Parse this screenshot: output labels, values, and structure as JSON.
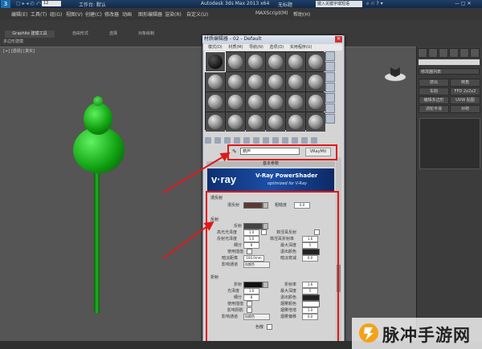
{
  "app": {
    "title": "工作台: 默认",
    "title_center": "Autodesk 3ds Max 2013 x64",
    "title_file": "无标题",
    "search_placeholder": "键入关键字或短语",
    "toolbar_dropdown": "12"
  },
  "menubar": [
    "编辑(E)",
    "工具(T)",
    "组(G)",
    "视图(V)",
    "创建(C)",
    "修改器",
    "动画",
    "图形编辑器",
    "渲染(R)",
    "自定义(U)",
    "MAXScript(M)",
    "帮助(H)"
  ],
  "ribbon": {
    "active_tab": "Graphite 建模工具",
    "tabs": [
      "自由形式",
      "选择",
      "对象绘制"
    ],
    "subtab": "多边形建模"
  },
  "viewport": {
    "label": "[+] [透视] [真实]"
  },
  "command_panel": {
    "dropdown": "修改器列表",
    "buttons": [
      "挤出",
      "倒角",
      "车削",
      "FFD 2x2x2",
      "编辑多边形",
      "UVW 贴图",
      "涡轮平滑",
      "对称"
    ]
  },
  "material_editor": {
    "title": "材质编辑器 - 02 - Default",
    "menu": [
      "模式(D)",
      "材质(M)",
      "导航(N)",
      "选项(O)",
      "实用程序(U)"
    ],
    "slot_count": 24,
    "selected_slot": 0,
    "material_name": "葫芦",
    "material_type": "VRayMtl",
    "basic_rollout": "基本参数",
    "vray_brand": "v·ray",
    "vray_title": "V-Ray PowerShader",
    "vray_subtitle": "optimized for V-Ray",
    "diffuse": {
      "group": "漫反射",
      "label": "漫反射",
      "rough_label": "粗糙度",
      "rough": "0.0"
    },
    "reflection": {
      "group": "反射",
      "reflect": "反射",
      "hilight": "高光光泽度",
      "hilight_val": "1.0",
      "refl_gloss": "反射光泽度",
      "refl_gloss_val": "1.0",
      "subdivs": "细分",
      "subdivs_val": "8",
      "use_interp": "使用插值",
      "dim_dist": "暗淡距离",
      "dim_dist_val": "100.0mm",
      "affect_ch": "影响通道",
      "affect_ch_val": "仅颜色",
      "fresnel": "菲涅耳反射",
      "fresnel_ior": "菲涅耳折射率",
      "fresnel_ior_val": "1.6",
      "max_depth": "最大深度",
      "max_depth_val": "5",
      "exit_color": "退出颜色",
      "dim_falloff": "暗淡衰减",
      "dim_falloff_val": "0.0"
    },
    "refraction": {
      "group": "折射",
      "refract": "折射",
      "ior": "折射率",
      "ior_val": "1.6",
      "gloss": "光泽度",
      "gloss_val": "1.0",
      "max_depth": "最大深度",
      "max_depth_val": "5",
      "subdivs": "细分",
      "subdivs_val": "8",
      "exit_color": "退出颜色",
      "use_interp": "使用插值",
      "fog_color": "烟雾颜色",
      "affect_shadows": "影响阴影",
      "fog_mult": "烟雾倍增",
      "fog_mult_val": "1.0",
      "affect_ch": "影响通道",
      "affect_ch_val": "仅颜色",
      "fog_bias": "烟雾偏移",
      "fog_bias_val": "0.0",
      "dispersion": "色散"
    }
  },
  "watermark": {
    "text": "脉冲手游网"
  },
  "colors": {
    "gourd": "#13a513",
    "highlight": "#e01818",
    "vray_blue": "#1b4fa6"
  }
}
